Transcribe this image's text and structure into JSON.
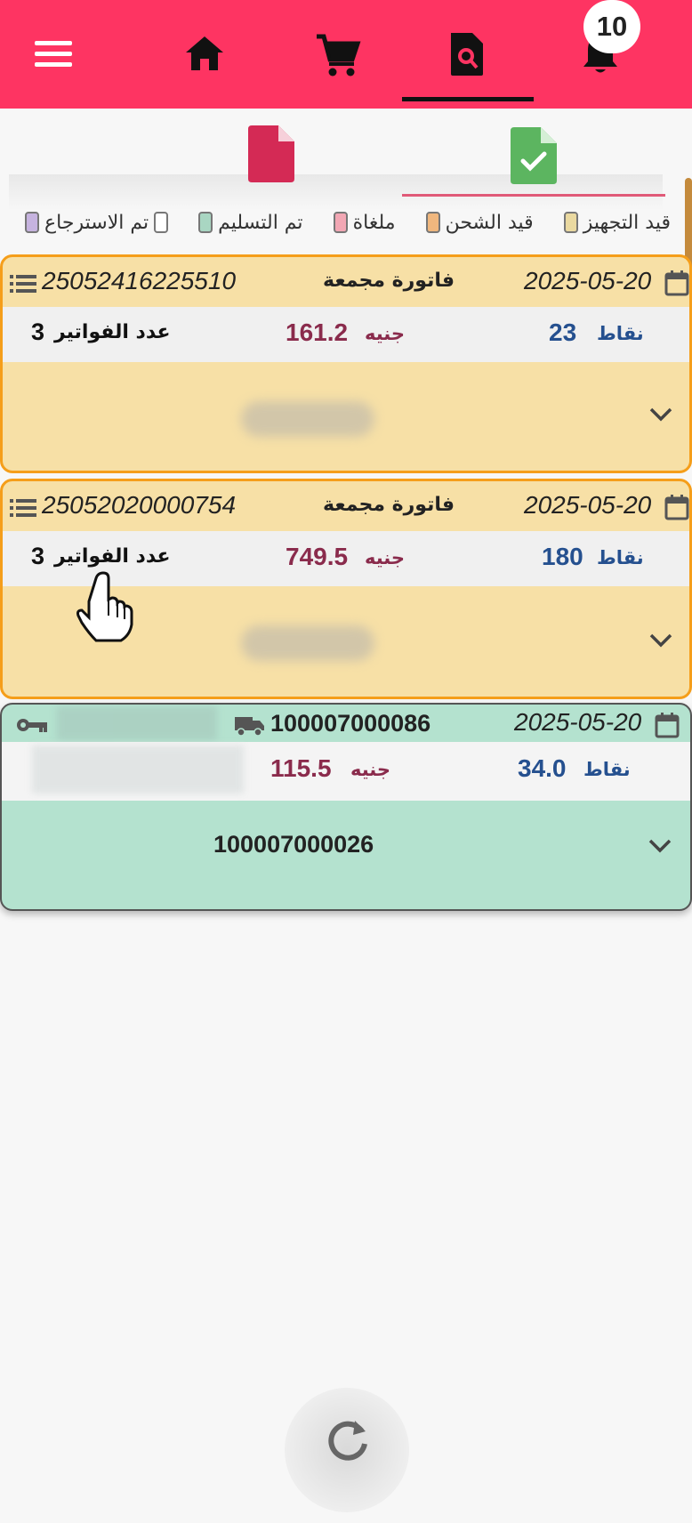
{
  "nav": {
    "notification_count": "10",
    "icons": [
      "menu-icon",
      "home-icon",
      "cart-icon",
      "search-document-icon",
      "bell-icon"
    ],
    "active": "search-document-icon"
  },
  "subtabs": {
    "icons": [
      "document-icon",
      "document-check-icon"
    ],
    "active": "document-check-icon"
  },
  "legend": [
    {
      "label": "تم الاسترجاع",
      "color": "#c6b3df"
    },
    {
      "label": "تم التسليم",
      "color": "#a9d6c2"
    },
    {
      "label": "ملغاة",
      "color": "#f2a7b4"
    },
    {
      "label": "قيد الشحن",
      "color": "#f0b77e"
    },
    {
      "label": "قيد التجهيز",
      "color": "#ead9a0"
    }
  ],
  "orders": [
    {
      "date": "2025-05-20",
      "type": "فاتورة مجمعة",
      "number": "25052416225510",
      "points_label": "نقاط",
      "points": "23",
      "amount_unit": "جنيه",
      "amount": "161.2",
      "count_label": "عدد الفواتير",
      "count": "3",
      "status_color": "#f7e0a6"
    },
    {
      "date": "2025-05-20",
      "type": "فاتورة مجمعة",
      "number": "25052020000754",
      "points_label": "نقاط",
      "points": "180",
      "amount_unit": "جنيه",
      "amount": "749.5",
      "count_label": "عدد الفواتير",
      "count": "3",
      "status_color": "#f7e0a6"
    },
    {
      "date": "2025-05-20",
      "number": "100007000086",
      "points_label": "نقاط",
      "points": "34.0",
      "amount_unit": "جنيه",
      "amount": "115.5",
      "footer_number": "100007000026",
      "status_color": "#b4e2cf"
    }
  ],
  "colors": {
    "brand": "#fe3462",
    "pending": "#f7e0a6",
    "delivered": "#b4e2cf",
    "amount": "#8a2b4c",
    "points": "#25508f"
  }
}
